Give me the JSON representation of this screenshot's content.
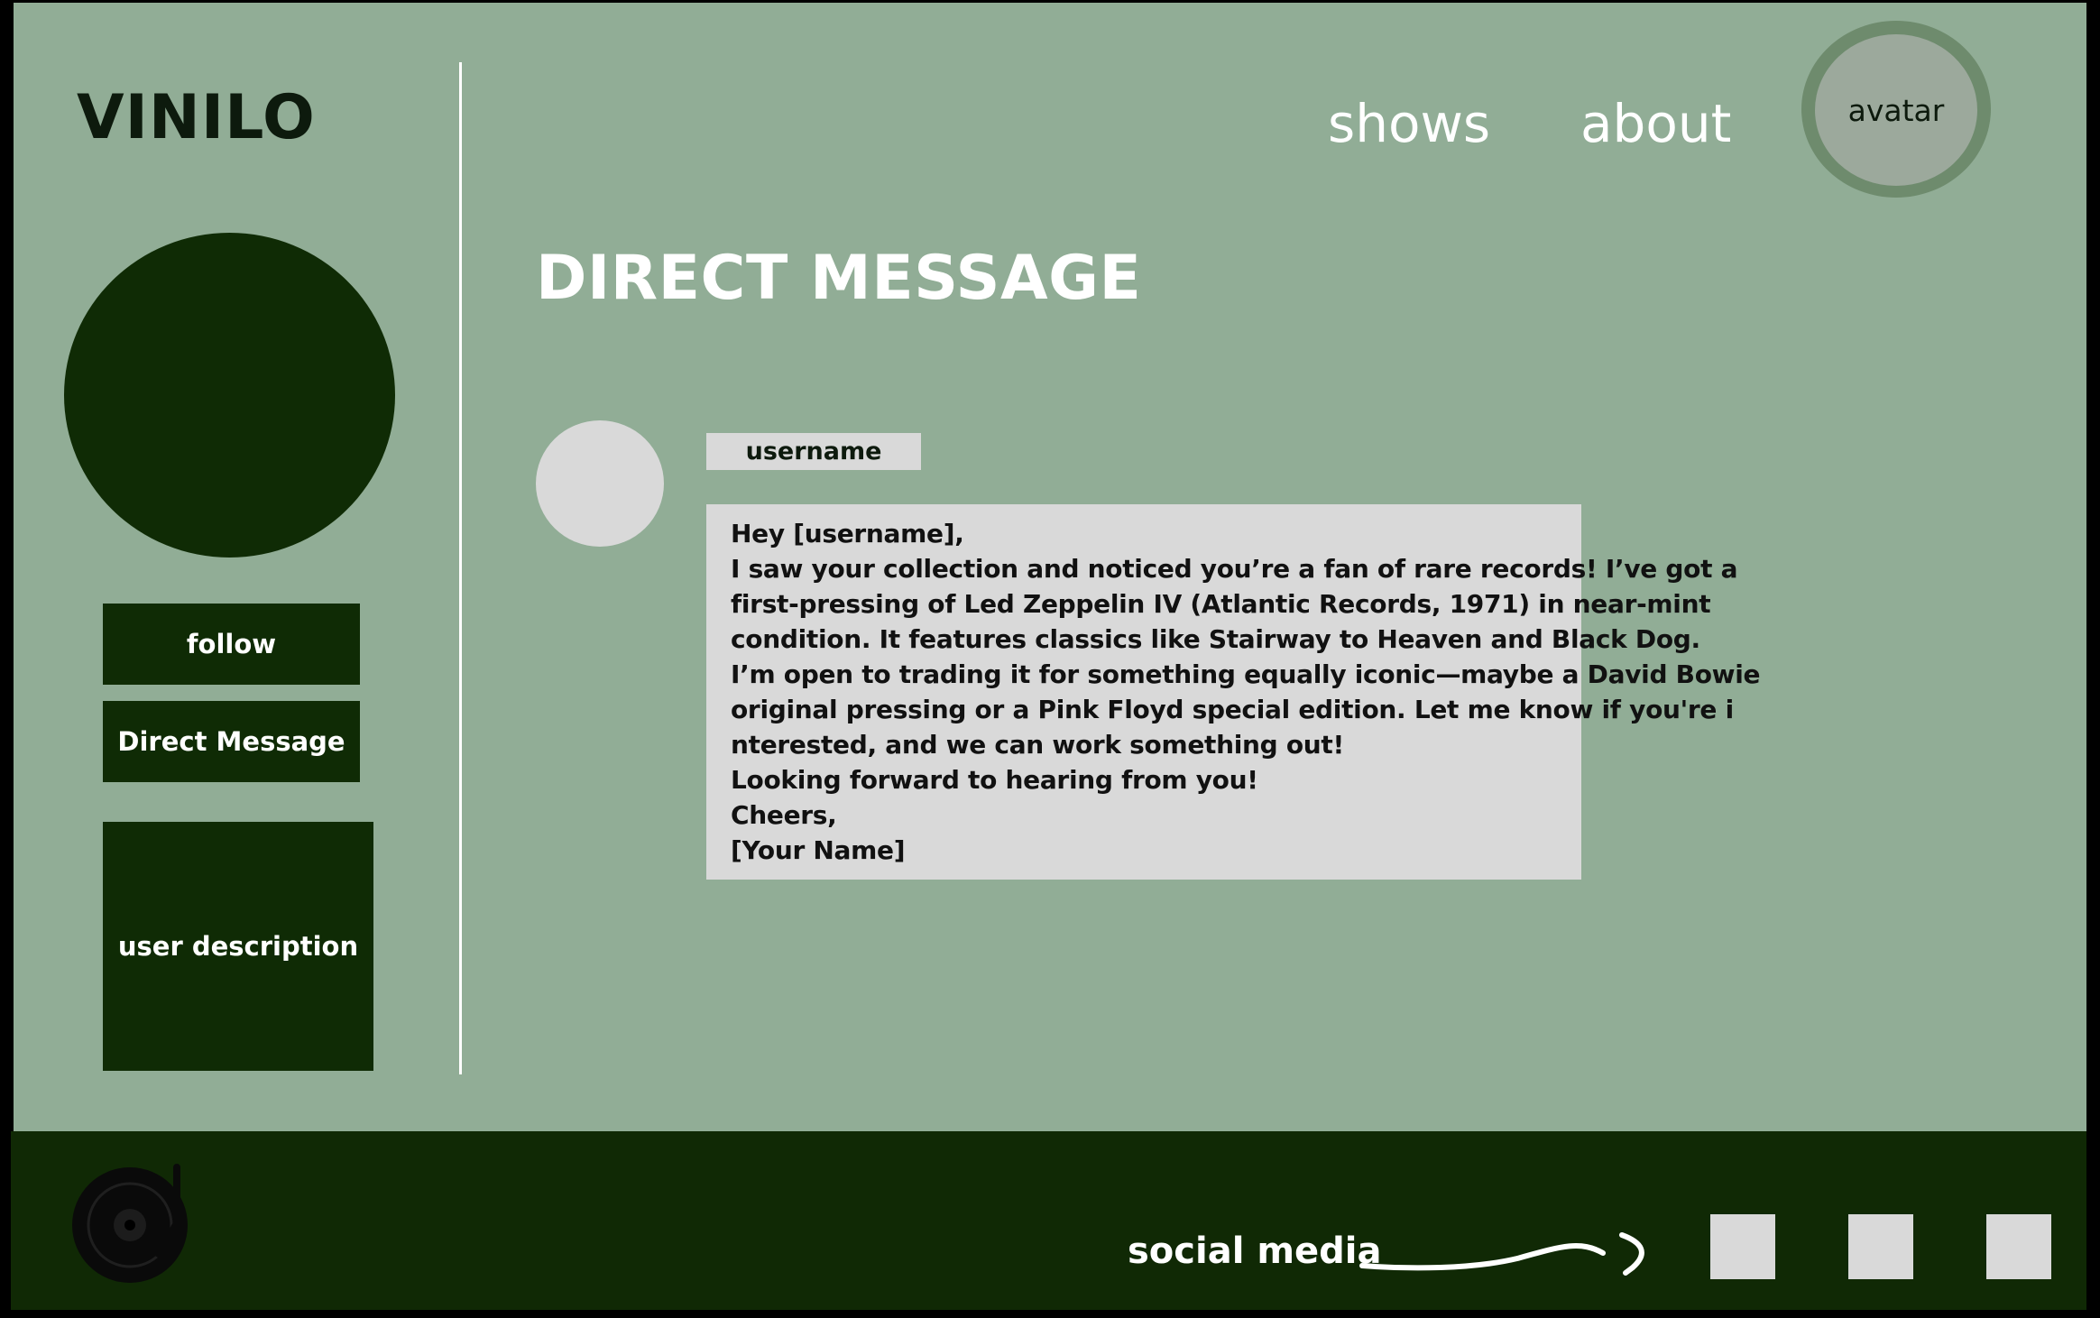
{
  "brand": {
    "logo": "VINILO"
  },
  "nav": {
    "shows": "shows",
    "about": "about",
    "avatar": "avatar"
  },
  "sidebar": {
    "follow_label": "follow",
    "dm_label": "Direct Message",
    "description": "user description"
  },
  "main": {
    "title": "DIRECT MESSAGE",
    "username": "username",
    "message_lines": [
      "Hey [username],",
      "I saw your collection and noticed you’re a fan of rare records! I’ve got a",
      "first-pressing of Led Zeppelin IV (Atlantic Records, 1971) in near-mint",
      "condition. It features classics like Stairway to Heaven and Black Dog.",
      "I’m open to trading it for something equally iconic—maybe a David Bowie",
      "original pressing or a Pink Floyd special edition. Let me know if you're i",
      "nterested, and we can work something out!",
      "Looking forward to hearing from you!",
      "Cheers,",
      "[Your Name]"
    ]
  },
  "footer": {
    "social_label": "social media"
  },
  "icons": {
    "turntable": "turntable-icon",
    "arrow": "squiggle-arrow-icon"
  },
  "colors": {
    "page_bg": "#91ad96",
    "dark_green": "#0f2b05",
    "footer_bg": "#102905",
    "light_gray": "#d9d9d9",
    "avatar_ring": "#6e8b6d"
  }
}
